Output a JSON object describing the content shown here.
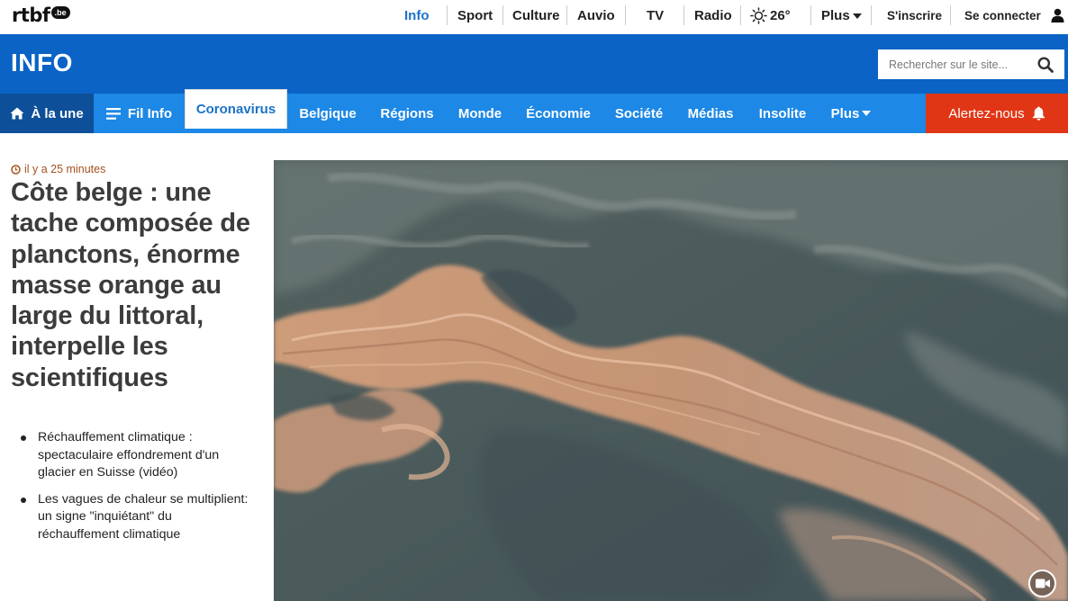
{
  "topbar": {
    "logo_text": "rtbf",
    "logo_suffix": ".be",
    "nav": [
      {
        "label": "Info"
      },
      {
        "label": "Sport"
      },
      {
        "label": "Culture"
      },
      {
        "label": "Auvio"
      },
      {
        "label": "TV"
      },
      {
        "label": "Radio"
      }
    ],
    "weather_temp": "26°",
    "plus_label": "Plus",
    "signup_label": "S'inscrire",
    "login_label": "Se connecter"
  },
  "header": {
    "title": "INFO",
    "search_placeholder": "Rechercher sur le site..."
  },
  "section_nav": {
    "home_label": "À la une",
    "filinfo_label": "Fil Info",
    "items": [
      "Coronavirus",
      "Belgique",
      "Régions",
      "Monde",
      "Économie",
      "Société",
      "Médias",
      "Insolite"
    ],
    "plus_label": "Plus",
    "alert_label": "Alertez-nous"
  },
  "article": {
    "timestamp": "il y a 25 minutes",
    "headline": "Côte belge : une tache composée de planctons, énorme masse orange au large du littoral, interpelle les scientifiques",
    "related": [
      "Réchauffement climatique : spectaculaire effondrement d'un glacier en Suisse (vidéo)",
      "Les vagues de chaleur se multiplient: un signe \"inquiétant\" du réchauffement climatique"
    ]
  },
  "colors": {
    "brand_blue": "#0a63c5",
    "nav_blue": "#1d88e5",
    "home_blue": "#0d4f99",
    "alert_red": "#e03616",
    "timestamp_orange": "#a3511b"
  }
}
